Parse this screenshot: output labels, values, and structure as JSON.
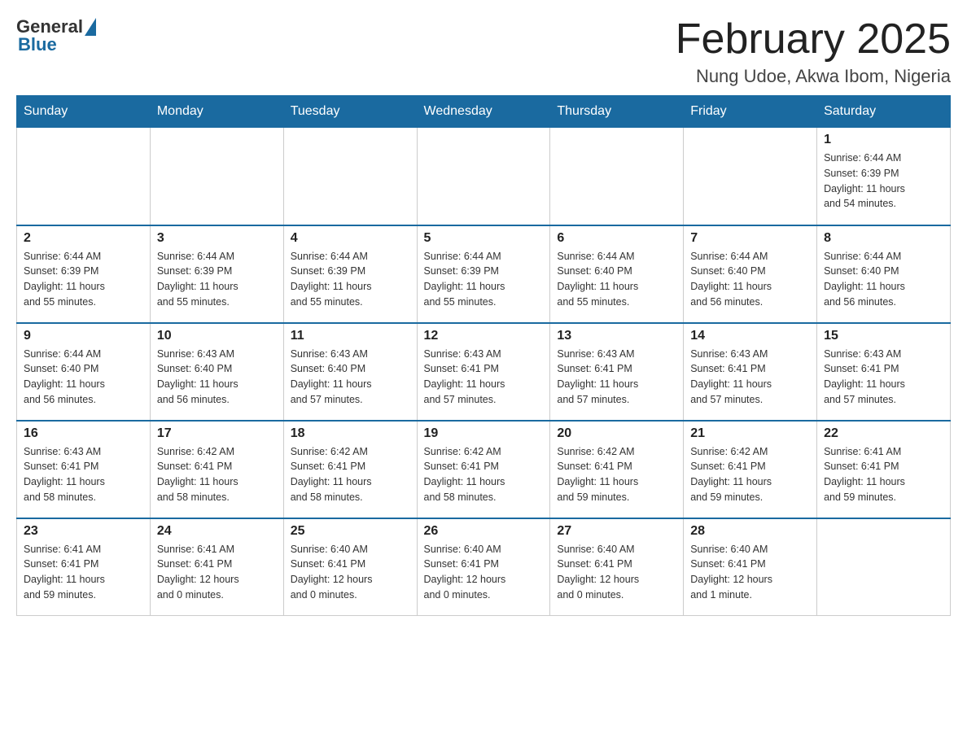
{
  "header": {
    "logo_general": "General",
    "logo_blue": "Blue",
    "month_title": "February 2025",
    "location": "Nung Udoe, Akwa Ibom, Nigeria"
  },
  "days_of_week": [
    "Sunday",
    "Monday",
    "Tuesday",
    "Wednesday",
    "Thursday",
    "Friday",
    "Saturday"
  ],
  "weeks": [
    {
      "days": [
        {
          "num": "",
          "info": ""
        },
        {
          "num": "",
          "info": ""
        },
        {
          "num": "",
          "info": ""
        },
        {
          "num": "",
          "info": ""
        },
        {
          "num": "",
          "info": ""
        },
        {
          "num": "",
          "info": ""
        },
        {
          "num": "1",
          "info": "Sunrise: 6:44 AM\nSunset: 6:39 PM\nDaylight: 11 hours\nand 54 minutes."
        }
      ]
    },
    {
      "days": [
        {
          "num": "2",
          "info": "Sunrise: 6:44 AM\nSunset: 6:39 PM\nDaylight: 11 hours\nand 55 minutes."
        },
        {
          "num": "3",
          "info": "Sunrise: 6:44 AM\nSunset: 6:39 PM\nDaylight: 11 hours\nand 55 minutes."
        },
        {
          "num": "4",
          "info": "Sunrise: 6:44 AM\nSunset: 6:39 PM\nDaylight: 11 hours\nand 55 minutes."
        },
        {
          "num": "5",
          "info": "Sunrise: 6:44 AM\nSunset: 6:39 PM\nDaylight: 11 hours\nand 55 minutes."
        },
        {
          "num": "6",
          "info": "Sunrise: 6:44 AM\nSunset: 6:40 PM\nDaylight: 11 hours\nand 55 minutes."
        },
        {
          "num": "7",
          "info": "Sunrise: 6:44 AM\nSunset: 6:40 PM\nDaylight: 11 hours\nand 56 minutes."
        },
        {
          "num": "8",
          "info": "Sunrise: 6:44 AM\nSunset: 6:40 PM\nDaylight: 11 hours\nand 56 minutes."
        }
      ]
    },
    {
      "days": [
        {
          "num": "9",
          "info": "Sunrise: 6:44 AM\nSunset: 6:40 PM\nDaylight: 11 hours\nand 56 minutes."
        },
        {
          "num": "10",
          "info": "Sunrise: 6:43 AM\nSunset: 6:40 PM\nDaylight: 11 hours\nand 56 minutes."
        },
        {
          "num": "11",
          "info": "Sunrise: 6:43 AM\nSunset: 6:40 PM\nDaylight: 11 hours\nand 57 minutes."
        },
        {
          "num": "12",
          "info": "Sunrise: 6:43 AM\nSunset: 6:41 PM\nDaylight: 11 hours\nand 57 minutes."
        },
        {
          "num": "13",
          "info": "Sunrise: 6:43 AM\nSunset: 6:41 PM\nDaylight: 11 hours\nand 57 minutes."
        },
        {
          "num": "14",
          "info": "Sunrise: 6:43 AM\nSunset: 6:41 PM\nDaylight: 11 hours\nand 57 minutes."
        },
        {
          "num": "15",
          "info": "Sunrise: 6:43 AM\nSunset: 6:41 PM\nDaylight: 11 hours\nand 57 minutes."
        }
      ]
    },
    {
      "days": [
        {
          "num": "16",
          "info": "Sunrise: 6:43 AM\nSunset: 6:41 PM\nDaylight: 11 hours\nand 58 minutes."
        },
        {
          "num": "17",
          "info": "Sunrise: 6:42 AM\nSunset: 6:41 PM\nDaylight: 11 hours\nand 58 minutes."
        },
        {
          "num": "18",
          "info": "Sunrise: 6:42 AM\nSunset: 6:41 PM\nDaylight: 11 hours\nand 58 minutes."
        },
        {
          "num": "19",
          "info": "Sunrise: 6:42 AM\nSunset: 6:41 PM\nDaylight: 11 hours\nand 58 minutes."
        },
        {
          "num": "20",
          "info": "Sunrise: 6:42 AM\nSunset: 6:41 PM\nDaylight: 11 hours\nand 59 minutes."
        },
        {
          "num": "21",
          "info": "Sunrise: 6:42 AM\nSunset: 6:41 PM\nDaylight: 11 hours\nand 59 minutes."
        },
        {
          "num": "22",
          "info": "Sunrise: 6:41 AM\nSunset: 6:41 PM\nDaylight: 11 hours\nand 59 minutes."
        }
      ]
    },
    {
      "days": [
        {
          "num": "23",
          "info": "Sunrise: 6:41 AM\nSunset: 6:41 PM\nDaylight: 11 hours\nand 59 minutes."
        },
        {
          "num": "24",
          "info": "Sunrise: 6:41 AM\nSunset: 6:41 PM\nDaylight: 12 hours\nand 0 minutes."
        },
        {
          "num": "25",
          "info": "Sunrise: 6:40 AM\nSunset: 6:41 PM\nDaylight: 12 hours\nand 0 minutes."
        },
        {
          "num": "26",
          "info": "Sunrise: 6:40 AM\nSunset: 6:41 PM\nDaylight: 12 hours\nand 0 minutes."
        },
        {
          "num": "27",
          "info": "Sunrise: 6:40 AM\nSunset: 6:41 PM\nDaylight: 12 hours\nand 0 minutes."
        },
        {
          "num": "28",
          "info": "Sunrise: 6:40 AM\nSunset: 6:41 PM\nDaylight: 12 hours\nand 1 minute."
        },
        {
          "num": "",
          "info": ""
        }
      ]
    }
  ]
}
